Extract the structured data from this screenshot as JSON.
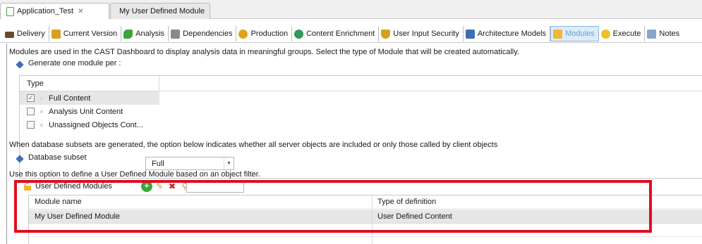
{
  "editor_tabs": [
    {
      "label": "Application_Test",
      "close": "✕"
    },
    {
      "label": "My User Defined Module"
    }
  ],
  "page_tabs": [
    {
      "label": "Delivery",
      "icon": "delivery-icon",
      "color": "#6b4a2b"
    },
    {
      "label": "Current Version",
      "icon": "version-icon",
      "color": "#d9a020"
    },
    {
      "label": "Analysis",
      "icon": "analysis-icon",
      "color": "#3aa63a"
    },
    {
      "label": "Dependencies",
      "icon": "dependencies-icon",
      "color": "#8a8a8a"
    },
    {
      "label": "Production",
      "icon": "production-icon",
      "color": "#e0a020"
    },
    {
      "label": "Content Enrichment",
      "icon": "enrichment-icon",
      "color": "#2f9a55"
    },
    {
      "label": "User Input Security",
      "icon": "security-icon",
      "color": "#d8a020"
    },
    {
      "label": "Architecture Models",
      "icon": "architecture-icon",
      "color": "#3d6fb5"
    },
    {
      "label": "Modules",
      "icon": "modules-icon",
      "color": "#f2b632",
      "active": true
    },
    {
      "label": "Execute",
      "icon": "execute-icon",
      "color": "#f0c020"
    },
    {
      "label": "Notes",
      "icon": "notes-icon",
      "color": "#8aa6cc"
    }
  ],
  "description": "Modules are used in the CAST Dashboard to display analysis data in meaningful groups. Select the type of Module that will be created automatically.",
  "generate_label": "Generate one module per :",
  "type_table": {
    "header": "Type",
    "rows": [
      {
        "label": "Full Content",
        "checked": true
      },
      {
        "label": "Analysis Unit Content",
        "checked": false
      },
      {
        "label": "Unassigned Objects Cont...",
        "checked": false
      }
    ]
  },
  "subset_info": "When database subsets are generated, the option below indicates whether all server objects are included or only those called by client objects",
  "database_subset": {
    "label": "Database subset",
    "value": "Full"
  },
  "udm_info": "Use this option to define a User Defined Module based on an object filter.",
  "udm": {
    "title": "User Defined Modules",
    "columns": [
      "Module name",
      "Type of definition"
    ],
    "rows": [
      {
        "name": "My User Defined Module",
        "type": "User Defined Content"
      }
    ]
  },
  "colors": {
    "accent": "#3f6fb8",
    "highlight": "#e00d20",
    "active_tab": "#dcecfb"
  }
}
